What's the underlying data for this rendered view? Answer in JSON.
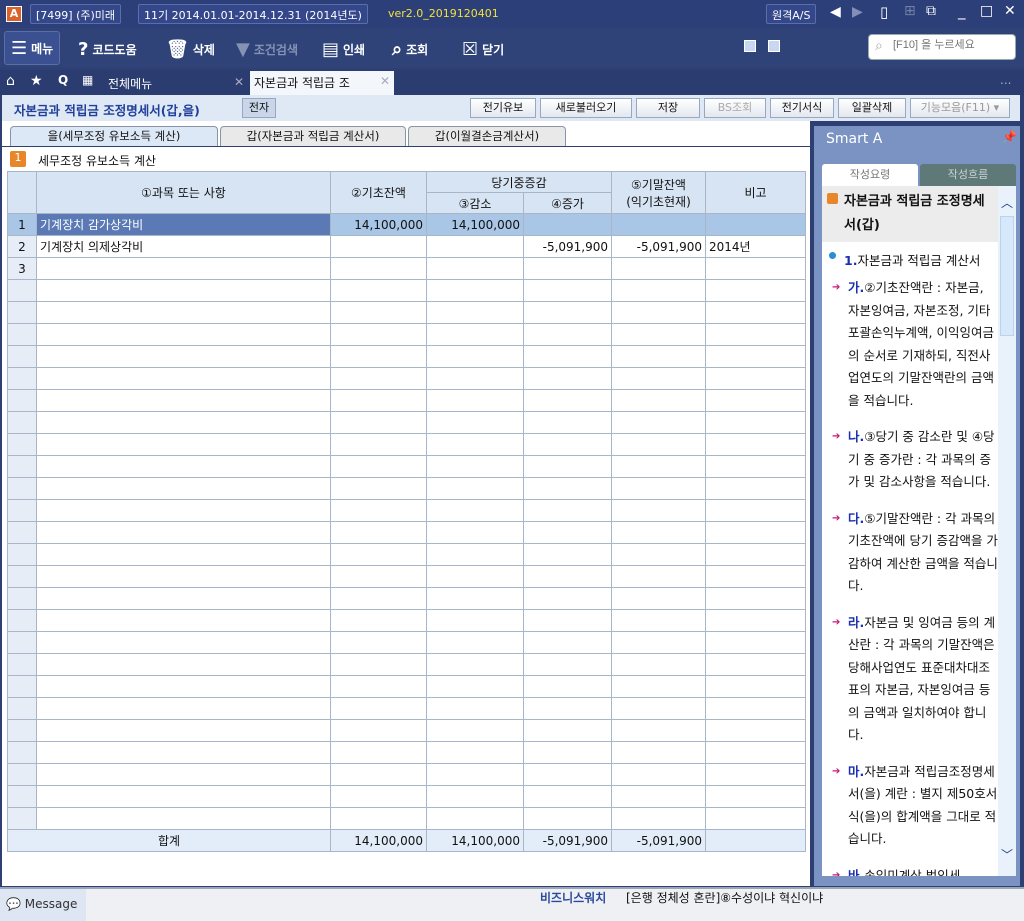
{
  "titlebar": {
    "company": "[7499] (주)미래",
    "period": "11기 2014.01.01-2014.12.31 (2014년도)",
    "version": "ver2.0_2019120401",
    "remote": "원격A/S"
  },
  "toolbar": {
    "menu": "메뉴",
    "code_help": "코드도움",
    "delete": "삭제",
    "filter": "조건검색",
    "print": "인쇄",
    "search": "조회",
    "close": "닫기",
    "search_placeholder": "[F10] 을 누르세요"
  },
  "tabs": {
    "all_menu": "전체메뉴",
    "current": "자본금과 적립금 조",
    "more": "..."
  },
  "page": {
    "title": "자본금과 적립금 조정명세서(갑,을)",
    "e_badge": "전자",
    "buttons": [
      "전기유보",
      "새로불러오기",
      "저장",
      "BS조회",
      "전기서식",
      "일괄삭제",
      "기능모음(F11)"
    ]
  },
  "subtabs": [
    "을(세무조정 유보소득 계산)",
    "갑(자본금과 적립금 계산서)",
    "갑(이월결손금계산서)"
  ],
  "section": {
    "num": "1",
    "title": "세무조정 유보소득 계산"
  },
  "table": {
    "headers": {
      "subject": "①과목 또는 사항",
      "opening": "②기초잔액",
      "change": "당기중증감",
      "decrease": "③감소",
      "increase": "④증가",
      "closing": "⑤기말잔액",
      "closing_sub": "(익기초현재)",
      "note": "비고"
    },
    "rows": [
      {
        "no": "1",
        "subject": "기계장치 감가상각비",
        "opening": "14,100,000",
        "decrease": "14,100,000",
        "increase": "",
        "closing": "",
        "note": ""
      },
      {
        "no": "2",
        "subject": "기계장치 의제상각비",
        "opening": "",
        "decrease": "",
        "increase": "-5,091,900",
        "closing": "-5,091,900",
        "note": "2014년"
      },
      {
        "no": "3",
        "subject": "",
        "opening": "",
        "decrease": "",
        "increase": "",
        "closing": "",
        "note": ""
      }
    ],
    "total": {
      "label": "합계",
      "opening": "14,100,000",
      "decrease": "14,100,000",
      "increase": "-5,091,900",
      "closing": "-5,091,900"
    }
  },
  "smart": {
    "title": "Smart A",
    "tab1": "작성요령",
    "tab2": "작성흐름",
    "heading": "자본금과 적립금 조정명세서(갑)",
    "item1_num": "1.",
    "item1": "자본금과 적립금 계산서",
    "hints": [
      {
        "k": "가.",
        "t": "②기초잔액란 : 자본금, 자본잉여금, 자본조정, 기타포괄손익누계액, 이익잉여금의 순서로 기재하되, 직전사업연도의 기말잔액란의 금액을 적습니다."
      },
      {
        "k": "나.",
        "t": "③당기 중 감소란 및 ④당기 중 증가란 : 각 과목의 증가 및 감소사항을 적습니다."
      },
      {
        "k": "다.",
        "t": "⑤기말잔액란 : 각 과목의 기초잔액에 당기 증감액을 가감하여 계산한 금액을 적습니다."
      },
      {
        "k": "라.",
        "t": "자본금 및 잉여금 등의 계산란 : 각 과목의 기말잔액은 당해사업연도 표준대차대조표의 자본금, 자본잉여금 등의 금액과 일치하여야 합니다."
      },
      {
        "k": "마.",
        "t": "자본금과 적립금조정명세서(을) 계란 : 별지 제50호서식(을)의 합계액을 그대로 적습니다."
      },
      {
        "k": "바.",
        "t": "손익미계상 법인세"
      }
    ]
  },
  "bottom": {
    "message": "Message",
    "ticker_label": "비즈니스워치",
    "ticker": "[은행 정체성 혼란]⑧수성이냐 혁신이냐"
  }
}
